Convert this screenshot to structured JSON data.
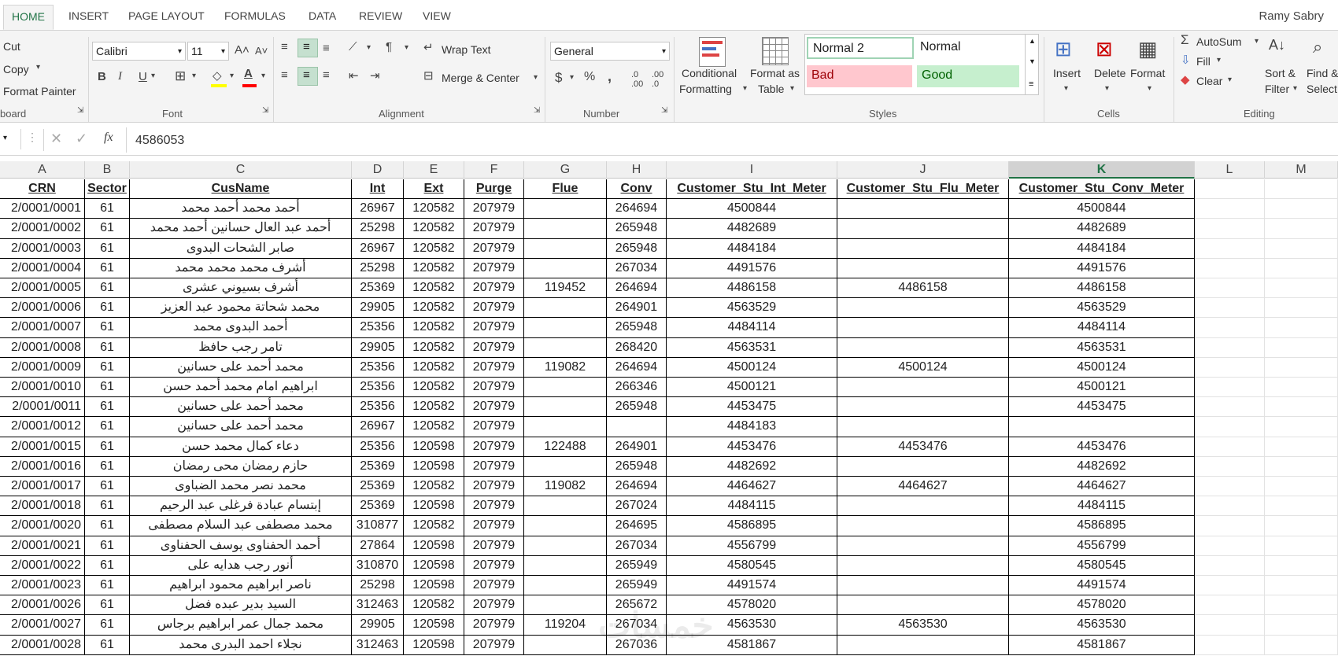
{
  "tabs": [
    "HOME",
    "INSERT",
    "PAGE LAYOUT",
    "FORMULAS",
    "DATA",
    "REVIEW",
    "VIEW"
  ],
  "user": "Ramy Sabry",
  "clipboard": {
    "cut": "Cut",
    "copy": "Copy",
    "format_painter": "Format Painter",
    "label": "board"
  },
  "font": {
    "name": "Calibri",
    "size": "11",
    "label": "Font"
  },
  "alignment": {
    "wrap": "Wrap Text",
    "merge": "Merge & Center",
    "label": "Alignment"
  },
  "number": {
    "format": "General",
    "label": "Number"
  },
  "styles": {
    "conditional_1": "Conditional",
    "conditional_2": "Formatting",
    "format_as_1": "Format as",
    "format_as_2": "Table",
    "normal2": "Normal 2",
    "normal": "Normal",
    "bad": "Bad",
    "good": "Good",
    "label": "Styles"
  },
  "cells_group": {
    "insert": "Insert",
    "delete": "Delete",
    "format": "Format",
    "label": "Cells"
  },
  "editing": {
    "autosum": "AutoSum",
    "fill": "Fill",
    "clear": "Clear",
    "sort_1": "Sort &",
    "sort_2": "Filter",
    "find_1": "Find &",
    "find_2": "Select",
    "label": "Editing"
  },
  "formula_bar": {
    "fx": "fx",
    "value": "4586053"
  },
  "colors": {
    "accent": "#217346",
    "bad_bg": "#ffc7ce",
    "bad_fg": "#9c0006",
    "good_bg": "#c6efce",
    "good_fg": "#006100"
  },
  "columns": [
    "A",
    "B",
    "C",
    "D",
    "E",
    "F",
    "G",
    "H",
    "I",
    "J",
    "K",
    "L",
    "M"
  ],
  "headers": [
    "CRN",
    "Sector",
    "CusName",
    "Int",
    "Ext",
    "Purge",
    "Flue",
    "Conv",
    "Customer_Stu_Int_Meter",
    "Customer_Stu_Flu_Meter",
    "Customer_Stu_Conv_Meter"
  ],
  "rows": [
    [
      "2/0001/0001",
      "61",
      "أحمد محمد أحمد محمد",
      "26967",
      "120582",
      "207979",
      "",
      "264694",
      "4500844",
      "",
      "4500844"
    ],
    [
      "2/0001/0002",
      "61",
      "أحمد عبد العال حسانين أحمد محمد",
      "25298",
      "120582",
      "207979",
      "",
      "265948",
      "4482689",
      "",
      "4482689"
    ],
    [
      "2/0001/0003",
      "61",
      "صابر الشحات البدوى",
      "26967",
      "120582",
      "207979",
      "",
      "265948",
      "4484184",
      "",
      "4484184"
    ],
    [
      "2/0001/0004",
      "61",
      "أشرف محمد محمد محمد",
      "25298",
      "120582",
      "207979",
      "",
      "267034",
      "4491576",
      "",
      "4491576"
    ],
    [
      "2/0001/0005",
      "61",
      "أشرف بسيوني عشرى",
      "25369",
      "120582",
      "207979",
      "119452",
      "264694",
      "4486158",
      "4486158",
      "4486158"
    ],
    [
      "2/0001/0006",
      "61",
      "محمد شحاتة محمود عبد العزيز",
      "29905",
      "120582",
      "207979",
      "",
      "264901",
      "4563529",
      "",
      "4563529"
    ],
    [
      "2/0001/0007",
      "61",
      "أحمد البدوى محمد",
      "25356",
      "120582",
      "207979",
      "",
      "265948",
      "4484114",
      "",
      "4484114"
    ],
    [
      "2/0001/0008",
      "61",
      "تامر رجب حافظ",
      "29905",
      "120582",
      "207979",
      "",
      "268420",
      "4563531",
      "",
      "4563531"
    ],
    [
      "2/0001/0009",
      "61",
      "محمد أحمد على حسانين",
      "25356",
      "120582",
      "207979",
      "119082",
      "264694",
      "4500124",
      "4500124",
      "4500124"
    ],
    [
      "2/0001/0010",
      "61",
      "ابراهيم امام محمد أحمد حسن",
      "25356",
      "120582",
      "207979",
      "",
      "266346",
      "4500121",
      "",
      "4500121"
    ],
    [
      "2/0001/0011",
      "61",
      "محمد أحمد على حسانين",
      "25356",
      "120582",
      "207979",
      "",
      "265948",
      "4453475",
      "",
      "4453475"
    ],
    [
      "2/0001/0012",
      "61",
      "محمد أحمد على حسانين",
      "26967",
      "120582",
      "207979",
      "",
      "",
      "4484183",
      "",
      ""
    ],
    [
      "2/0001/0015",
      "61",
      "دعاء كمال محمد حسن",
      "25356",
      "120598",
      "207979",
      "122488",
      "264901",
      "4453476",
      "4453476",
      "4453476"
    ],
    [
      "2/0001/0016",
      "61",
      "حازم رمضان محى رمضان",
      "25369",
      "120598",
      "207979",
      "",
      "265948",
      "4482692",
      "",
      "4482692"
    ],
    [
      "2/0001/0017",
      "61",
      "محمد نصر محمد الضباوى",
      "25369",
      "120582",
      "207979",
      "119082",
      "264694",
      "4464627",
      "4464627",
      "4464627"
    ],
    [
      "2/0001/0018",
      "61",
      "إبتسام عبادة فرغلى عبد الرحيم",
      "25369",
      "120598",
      "207979",
      "",
      "267024",
      "4484115",
      "",
      "4484115"
    ],
    [
      "2/0001/0020",
      "61",
      "محمد مصطفى عبد السلام مصطفى",
      "310877",
      "120582",
      "207979",
      "",
      "264695",
      "4586895",
      "",
      "4586895"
    ],
    [
      "2/0001/0021",
      "61",
      "أحمد الحفناوى يوسف الحفناوى",
      "27864",
      "120598",
      "207979",
      "",
      "267034",
      "4556799",
      "",
      "4556799"
    ],
    [
      "2/0001/0022",
      "61",
      "أنور رجب هدايه على",
      "310870",
      "120598",
      "207979",
      "",
      "265949",
      "4580545",
      "",
      "4580545"
    ],
    [
      "2/0001/0023",
      "61",
      "ناصر ابراهيم محمود ابراهيم",
      "25298",
      "120598",
      "207979",
      "",
      "265949",
      "4491574",
      "",
      "4491574"
    ],
    [
      "2/0001/0026",
      "61",
      "السيد بدير عبده فضل",
      "312463",
      "120582",
      "207979",
      "",
      "265672",
      "4578020",
      "",
      "4578020"
    ],
    [
      "2/0001/0027",
      "61",
      "محمد جمال عمر ابراهيم برجاس",
      "29905",
      "120598",
      "207979",
      "119204",
      "267034",
      "4563530",
      "4563530",
      "4563530"
    ],
    [
      "2/0001/0028",
      "61",
      "نجلاء احمد البدرى محمد",
      "312463",
      "120598",
      "207979",
      "",
      "267036",
      "4581867",
      "",
      "4581867"
    ]
  ]
}
